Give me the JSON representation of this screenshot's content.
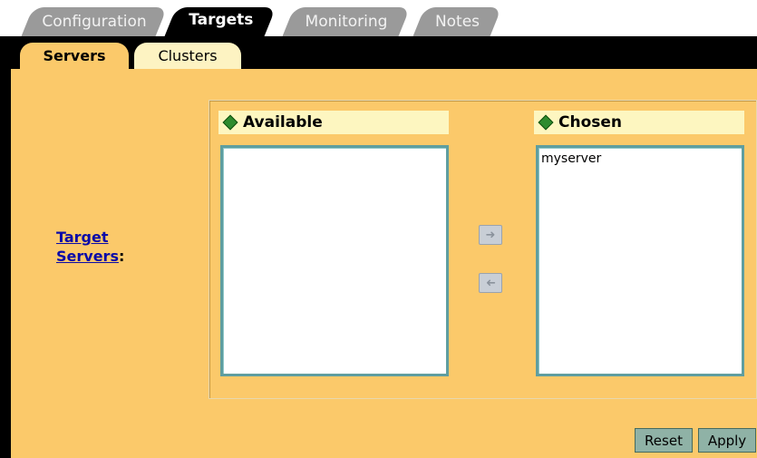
{
  "top_tabs": [
    {
      "label": "Configuration",
      "active": false
    },
    {
      "label": "Targets",
      "active": true
    },
    {
      "label": "Monitoring",
      "active": false
    },
    {
      "label": "Notes",
      "active": false
    }
  ],
  "sub_tabs": [
    {
      "label": "Servers",
      "active": true
    },
    {
      "label": "Clusters",
      "active": false
    }
  ],
  "target_field": {
    "label_word1": "Target",
    "label_word2": "Servers",
    "suffix": ":"
  },
  "available": {
    "header": "Available",
    "items": []
  },
  "chosen": {
    "header": "Chosen",
    "items": [
      "myserver"
    ]
  },
  "move_buttons": {
    "right_icon": "arrow-right-icon",
    "left_icon": "arrow-left-icon"
  },
  "actions": {
    "reset_label": "Reset",
    "apply_label": "Apply"
  },
  "colors": {
    "panel": "#fbc96a",
    "header": "#fdf6c0",
    "listbox_border": "#5f9ea0",
    "link": "#0a0aa8",
    "button": "#8fb2a6"
  }
}
